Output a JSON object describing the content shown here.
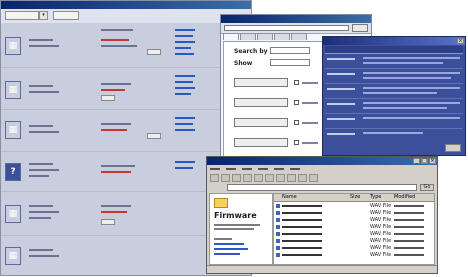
{
  "catalog": {
    "title": "",
    "toolbar": {
      "filter_label": "",
      "view_label": ""
    },
    "rows": [
      {
        "thumb_icon": "device-icon",
        "thumb_color": "#3c4f9a"
      },
      {
        "thumb_icon": "device-icon",
        "thumb_color": "#3c4f9a"
      },
      {
        "thumb_icon": "device-icon",
        "thumb_color": "#3c4f9a"
      },
      {
        "thumb_icon": "help-icon",
        "thumb_color": "#3c4f9a"
      },
      {
        "thumb_icon": "device-icon",
        "thumb_color": "#3c4f9a"
      },
      {
        "thumb_icon": "device-icon",
        "thumb_color": "#3c4f9a"
      }
    ]
  },
  "search": {
    "title": "",
    "go_label": "",
    "search_by_label": "Search by",
    "show_label": "Show",
    "search_by_value": "",
    "show_value": "",
    "buttons": [
      "",
      "",
      "",
      ""
    ]
  },
  "info": {
    "title": "",
    "columns": [
      "",
      ""
    ]
  },
  "explorer": {
    "title": "",
    "go_label": "Go",
    "address": "",
    "folder_name": "Firmware",
    "columns": [
      "Name",
      "Size",
      "Type",
      "Modified"
    ],
    "files": [
      {
        "size": "",
        "type": "WAV File"
      },
      {
        "size": "",
        "type": "WAV File"
      },
      {
        "size": "",
        "type": "WAV File"
      },
      {
        "size": "",
        "type": "WAV File"
      },
      {
        "size": "",
        "type": "WAV File"
      },
      {
        "size": "",
        "type": "WAV File"
      },
      {
        "size": "",
        "type": "WAV File"
      },
      {
        "size": "",
        "type": "WAV File"
      }
    ]
  },
  "colors": {
    "catalog_background": "#c9cede",
    "info_background": "#3b4f9b",
    "titlebar": "#0a246a",
    "folder": "#f5d25b",
    "link": "#2b59c3"
  }
}
